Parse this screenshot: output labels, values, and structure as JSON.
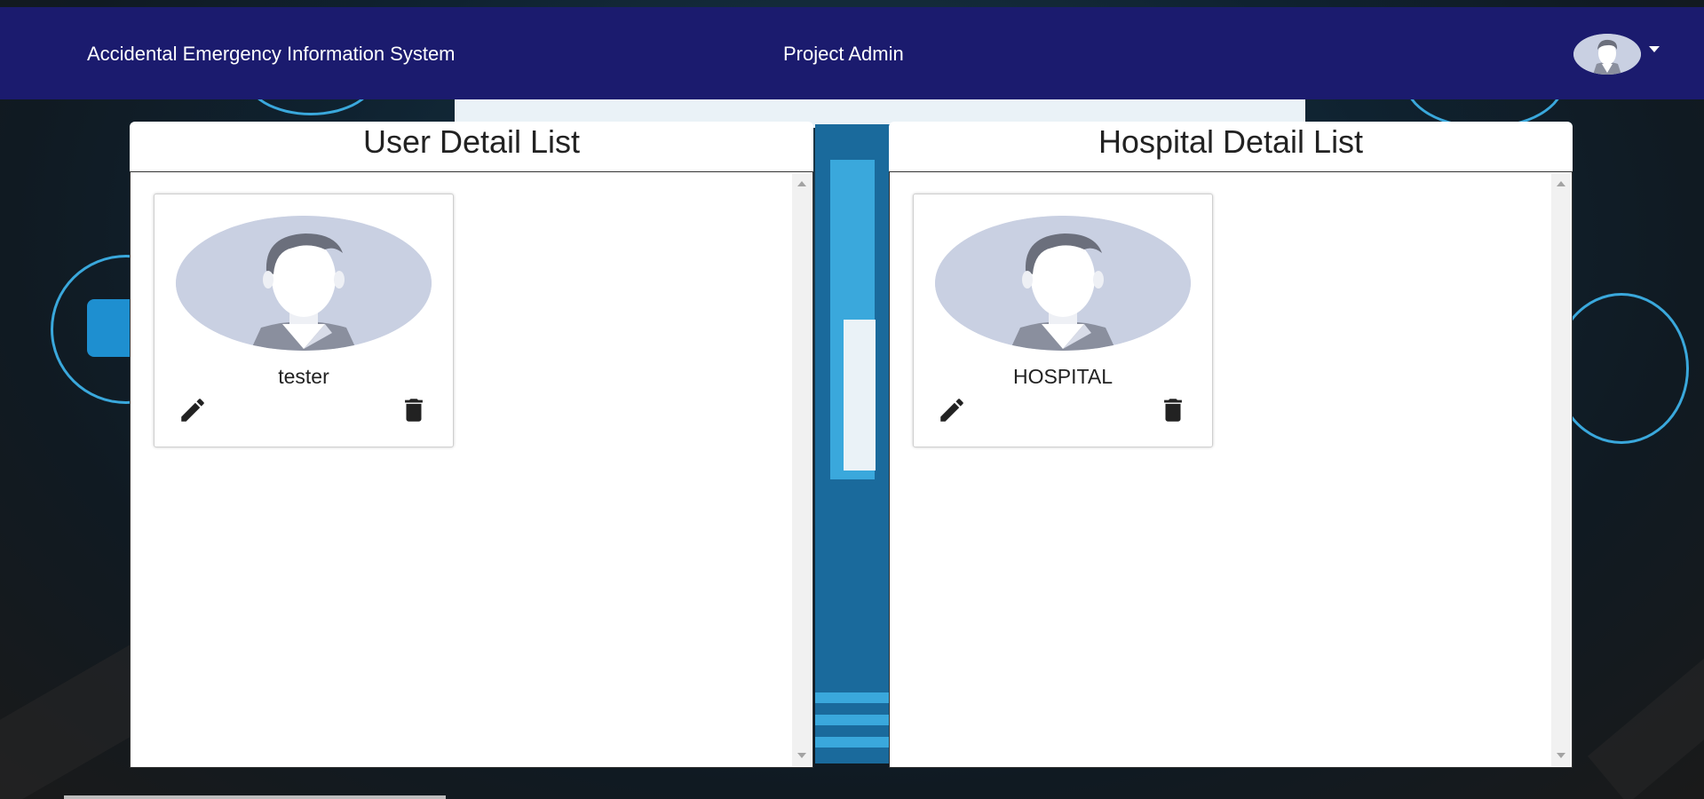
{
  "header": {
    "app_title": "Accidental Emergency Information System",
    "role_label": "Project Admin",
    "avatar_icon": "user-avatar-icon",
    "dropdown_icon": "caret-down-icon"
  },
  "user_panel": {
    "title": "User Detail List",
    "cards": [
      {
        "name": "tester",
        "edit_icon": "pencil-icon",
        "delete_icon": "trash-icon"
      }
    ]
  },
  "hospital_panel": {
    "title": "Hospital Detail List",
    "cards": [
      {
        "name": "HOSPITAL",
        "edit_icon": "pencil-icon",
        "delete_icon": "trash-icon"
      }
    ]
  },
  "colors": {
    "navbar": "#1b1b6e",
    "avatar_bg": "#c9d0e2",
    "accent_blue": "#1e8fd0"
  }
}
